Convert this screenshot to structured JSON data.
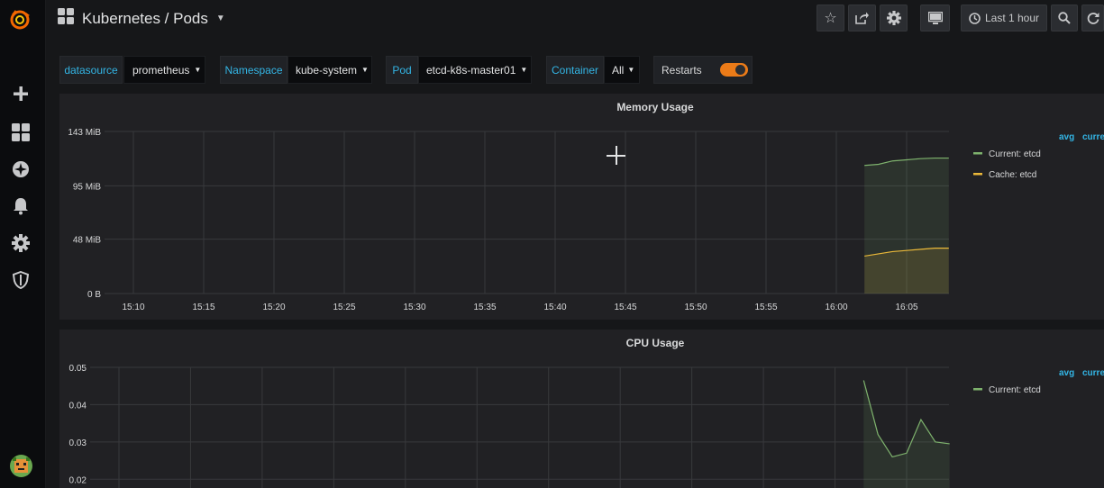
{
  "header": {
    "title": "Kubernetes / Pods",
    "time_range_label": "Last 1 hour"
  },
  "icons": {
    "logo": "grafana-logo-icon",
    "create": "plus-icon",
    "dashboards": "grid-icon",
    "explore": "compass-icon",
    "alerting": "bell-icon",
    "configuration": "gear-icon",
    "server_admin": "shield-icon",
    "star": "star-icon",
    "share": "share-icon",
    "settings": "gear-icon",
    "tv_mode": "monitor-icon",
    "clock": "clock-icon",
    "zoom_out": "search-icon",
    "refresh": "refresh-icon",
    "dashboard": "grid-icon"
  },
  "variables": {
    "datasource": {
      "label": "datasource",
      "value": "prometheus"
    },
    "namespace": {
      "label": "Namespace",
      "value": "kube-system"
    },
    "pod": {
      "label": "Pod",
      "value": "etcd-k8s-master01"
    },
    "container": {
      "label": "Container",
      "value": "All"
    },
    "restarts": {
      "label": "Restarts",
      "enabled": true
    }
  },
  "colors": {
    "accent_blue": "#33b5e5",
    "toggle_orange": "#eb7b18",
    "series_green": "#7eb26d",
    "series_yellow": "#eab839"
  },
  "chart_data": [
    {
      "type": "line",
      "title": "Memory Usage",
      "x_ticks": [
        "15:10",
        "15:15",
        "15:20",
        "15:25",
        "15:30",
        "15:35",
        "15:40",
        "15:45",
        "15:50",
        "15:55",
        "16:00",
        "16:05"
      ],
      "y_ticks": [
        "0 B",
        "48 MiB",
        "95 MiB",
        "143 MiB"
      ],
      "ylim": [
        0,
        143
      ],
      "yunit": "MiB",
      "legend_columns": [
        "avg",
        "curre"
      ],
      "legend_position": "right",
      "series": [
        {
          "name": "Current: etcd",
          "color": "#7eb26d",
          "x": [
            "16:02",
            "16:03",
            "16:04",
            "16:05",
            "16:06",
            "16:07",
            "16:08"
          ],
          "values": [
            113,
            114,
            117,
            118,
            119,
            119.5,
            119.5
          ]
        },
        {
          "name": "Cache: etcd",
          "color": "#eab839",
          "x": [
            "16:02",
            "16:03",
            "16:04",
            "16:05",
            "16:06",
            "16:07",
            "16:08"
          ],
          "values": [
            33,
            35,
            37,
            38,
            39,
            40,
            40
          ]
        }
      ]
    },
    {
      "type": "line",
      "title": "CPU Usage",
      "x_ticks": [],
      "y_ticks": [
        "0.02",
        "0.03",
        "0.04",
        "0.05"
      ],
      "ylim": [
        0.015,
        0.05
      ],
      "legend_columns": [
        "avg",
        "curre"
      ],
      "legend_position": "right",
      "series": [
        {
          "name": "Current: etcd",
          "color": "#7eb26d",
          "x": [
            "16:02",
            "16:03",
            "16:04",
            "16:05",
            "16:06",
            "16:07",
            "16:08"
          ],
          "values": [
            0.0465,
            0.032,
            0.026,
            0.027,
            0.036,
            0.03,
            0.0295
          ]
        }
      ]
    }
  ]
}
